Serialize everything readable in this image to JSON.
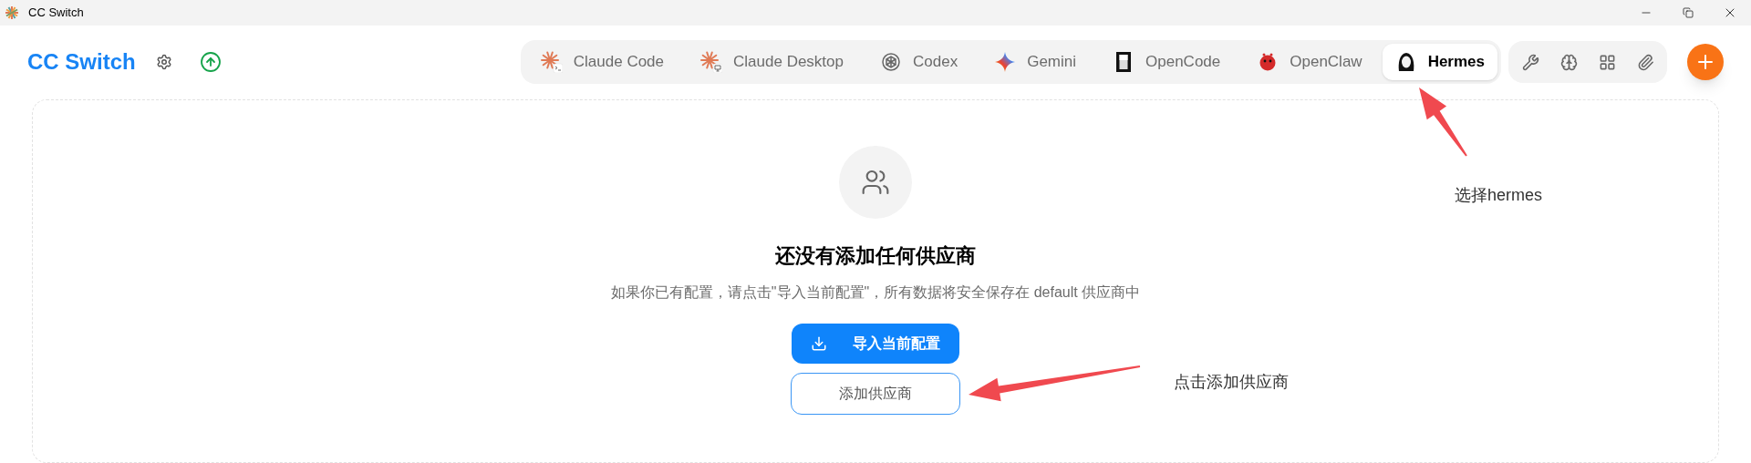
{
  "window": {
    "title": "CC Switch"
  },
  "header": {
    "app_name": "CC Switch"
  },
  "tabs": [
    {
      "label": "Claude Code",
      "selected": false
    },
    {
      "label": "Claude Desktop",
      "selected": false
    },
    {
      "label": "Codex",
      "selected": false
    },
    {
      "label": "Gemini",
      "selected": false
    },
    {
      "label": "OpenCode",
      "selected": false
    },
    {
      "label": "OpenClaw",
      "selected": false
    },
    {
      "label": "Hermes",
      "selected": true
    }
  ],
  "empty_state": {
    "title": "还没有添加任何供应商",
    "description": "如果你已有配置，请点击\"导入当前配置\"，所有数据将安全保存在 default 供应商中",
    "primary_button": "导入当前配置",
    "secondary_button": "添加供应商"
  },
  "annotations": [
    {
      "text": "选择hermes"
    },
    {
      "text": "点击添加供应商"
    }
  ]
}
